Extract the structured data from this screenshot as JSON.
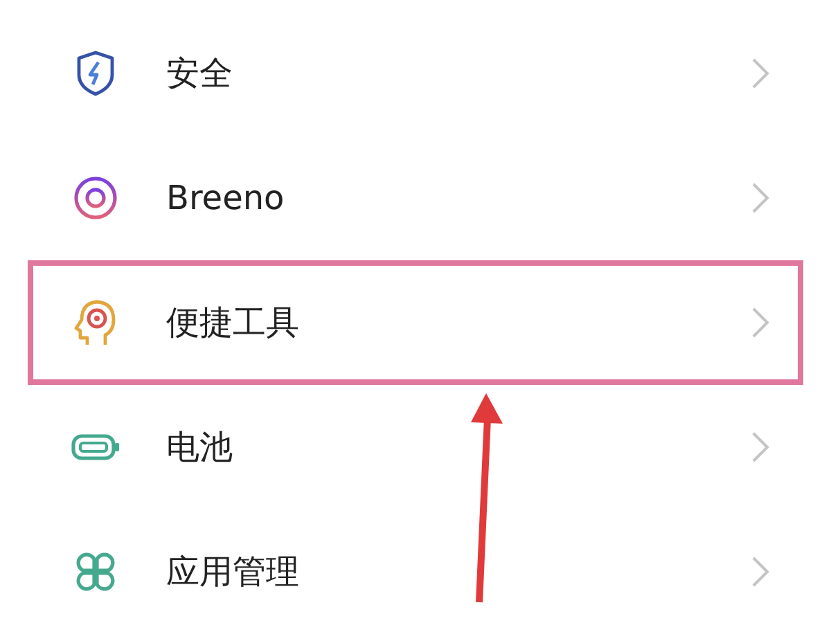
{
  "settings_items": [
    {
      "kind": "shield",
      "label": "安全",
      "highlighted": false
    },
    {
      "kind": "ring",
      "label": "Breeno",
      "highlighted": false
    },
    {
      "kind": "head",
      "label": "便捷工具",
      "highlighted": true
    },
    {
      "kind": "battery",
      "label": "电池",
      "highlighted": false
    },
    {
      "kind": "grid",
      "label": "应用管理",
      "highlighted": false
    }
  ],
  "annotations": [
    {
      "kind": "arrow"
    }
  ]
}
